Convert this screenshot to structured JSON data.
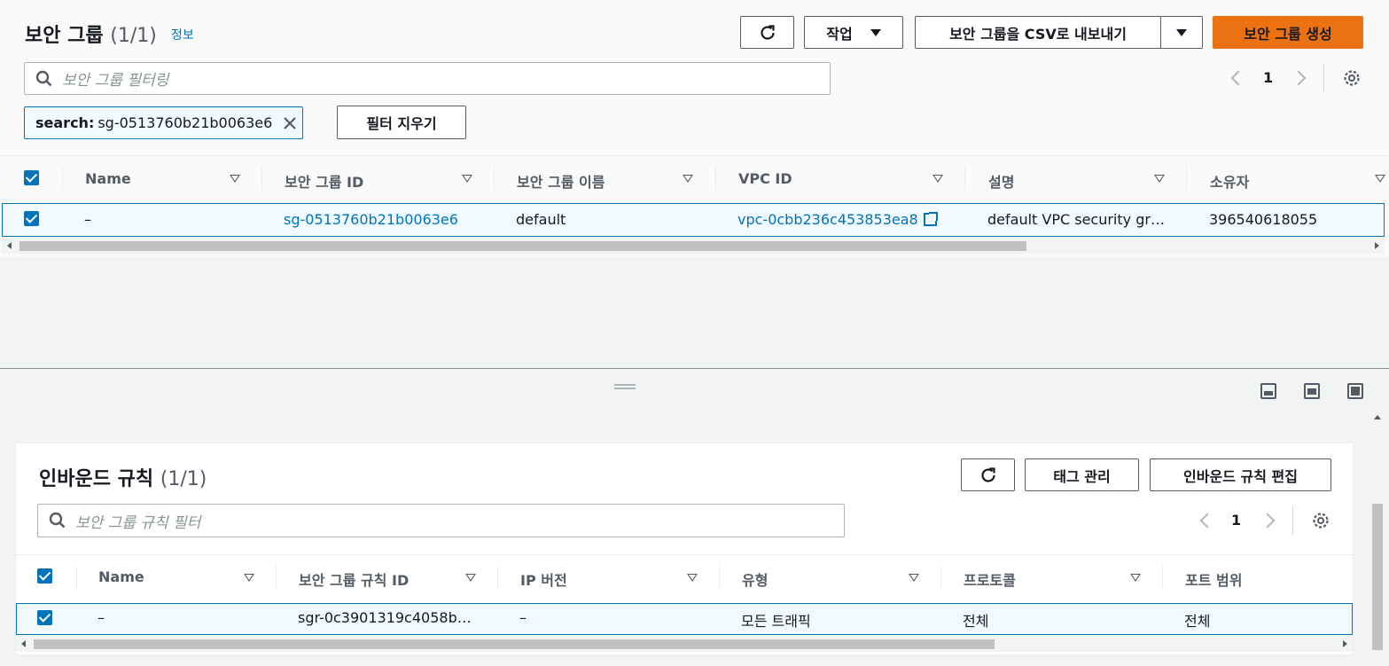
{
  "top_panel": {
    "title": "보안 그룹",
    "count": "(1/1)",
    "info_link": "정보",
    "actions_label": "작업",
    "export_label": "보안 그룹을 CSV로 내보내기",
    "create_label": "보안 그룹 생성",
    "search_placeholder": "보안 그룹 필터링",
    "page_number": "1",
    "token_key": "search:",
    "token_value": "sg-0513760b21b0063e6",
    "clear_filters_label": "필터 지우기",
    "columns": [
      "Name",
      "보안 그룹 ID",
      "보안 그룹 이름",
      "VPC ID",
      "설명",
      "소유자"
    ],
    "rows": [
      {
        "name": "–",
        "group_id": "sg-0513760b21b0063e6",
        "group_name": "default",
        "vpc_id": "vpc-0cbb236c453853ea8",
        "description": "default VPC security gr…",
        "owner": "396540618055"
      }
    ]
  },
  "bottom_panel": {
    "title": "인바운드 규칙",
    "count": "(1/1)",
    "manage_tags_label": "태그 관리",
    "edit_rules_label": "인바운드 규칙 편집",
    "search_placeholder": "보안 그룹 규칙 필터",
    "page_number": "1",
    "columns": [
      "Name",
      "보안 그룹 규칙 ID",
      "IP 버전",
      "유형",
      "프로토콜",
      "포트 범위"
    ],
    "rows": [
      {
        "name": "–",
        "rule_id": "sgr-0c3901319c4058b…",
        "ip_version": "–",
        "type": "모든 트래픽",
        "protocol": "전체",
        "port_range": "전체"
      }
    ]
  },
  "colors": {
    "accent": "#0073bb",
    "primary_button": "#ec7211"
  },
  "icons": [
    "refresh-icon",
    "caret-down-icon",
    "search-icon",
    "close-icon",
    "chevron-left-icon",
    "chevron-right-icon",
    "settings-icon",
    "external-link-icon",
    "checkbox-checked-icon",
    "dock-bottom-icon",
    "dock-side-icon",
    "dock-full-icon"
  ]
}
